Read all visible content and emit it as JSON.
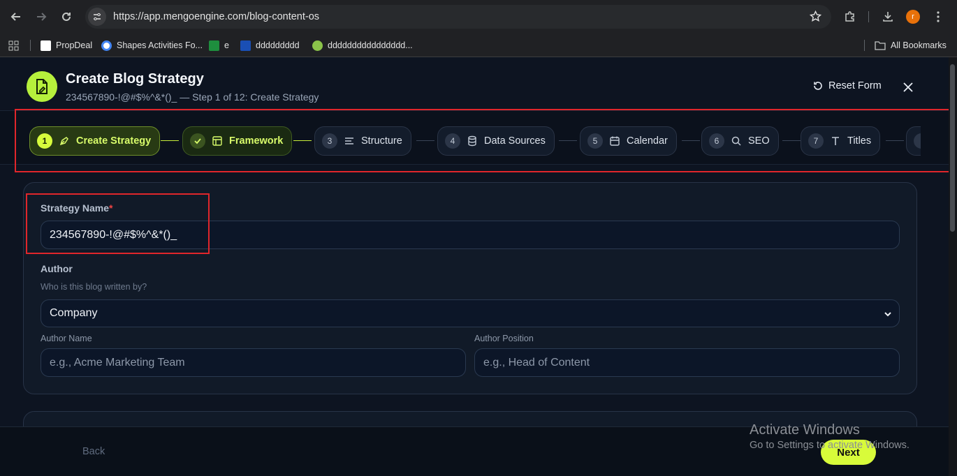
{
  "browser": {
    "url": "https://app.mengoengine.com/blog-content-os",
    "profile_initial": "r",
    "bookmarks": [
      {
        "label": "PropDeal",
        "color": "#ffffff"
      },
      {
        "label": "Shapes Activities Fo...",
        "color": "#4285f4"
      },
      {
        "label": "e",
        "color": "#1e8e3e"
      },
      {
        "label": "ddddddddd",
        "color": "#1a4fb5"
      },
      {
        "label": "dddddddddddddddd...",
        "color": "#8bc34a"
      }
    ],
    "all_bookmarks_label": "All Bookmarks"
  },
  "header": {
    "title": "Create Blog Strategy",
    "subtitle": "234567890-!@#$%^&*()_ — Step 1 of 12: Create Strategy",
    "reset_label": "Reset Form"
  },
  "steps": [
    {
      "num": "1",
      "label": "Create Strategy",
      "state": "active"
    },
    {
      "num": "",
      "label": "Framework",
      "state": "done"
    },
    {
      "num": "3",
      "label": "Structure",
      "state": "pending"
    },
    {
      "num": "4",
      "label": "Data Sources",
      "state": "pending"
    },
    {
      "num": "5",
      "label": "Calendar",
      "state": "pending"
    },
    {
      "num": "6",
      "label": "SEO",
      "state": "pending"
    },
    {
      "num": "7",
      "label": "Titles",
      "state": "pending"
    }
  ],
  "form": {
    "strategy_name_label": "Strategy Name",
    "required_mark": "*",
    "strategy_name_value": "234567890-!@#$%^&*()_",
    "author_label": "Author",
    "author_hint": "Who is this blog written by?",
    "author_selected": "Company",
    "author_name_label": "Author Name",
    "author_name_placeholder": "e.g., Acme Marketing Team",
    "author_position_label": "Author Position",
    "author_position_placeholder": "e.g., Head of Content"
  },
  "footer": {
    "back_label": "Back",
    "next_label": "Next"
  },
  "watermark": {
    "line1": "Activate Windows",
    "line2": "Go to Settings to activate Windows."
  },
  "colors": {
    "accent": "#d8fb3a",
    "annotation": "#e0262b"
  }
}
